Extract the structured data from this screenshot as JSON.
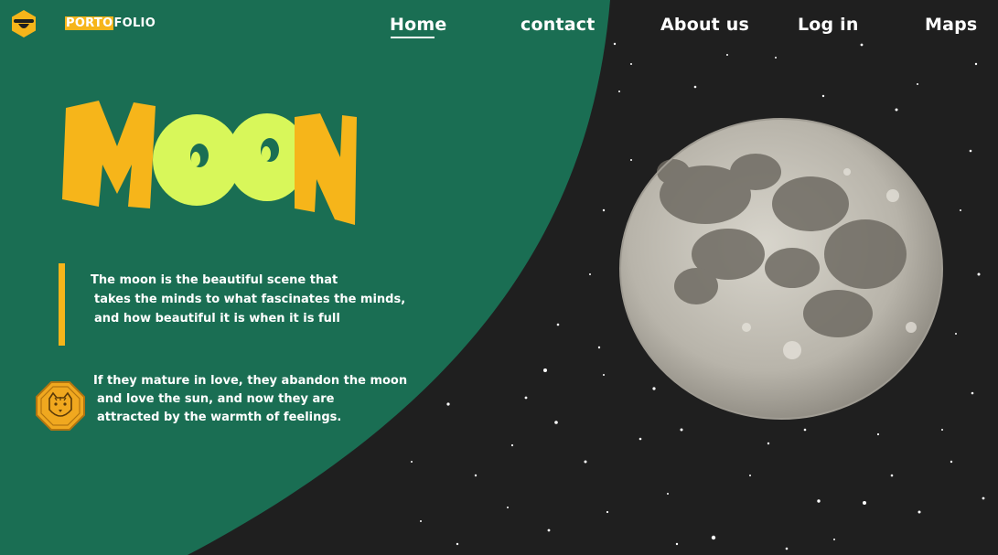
{
  "brand": {
    "highlight": "PORTO",
    "rest": "FOLIO"
  },
  "nav": {
    "home": "Home",
    "contact": "contact",
    "about": "About us",
    "login": "Log in",
    "maps": "Maps",
    "active": "Home"
  },
  "hero": {
    "title": "MOON",
    "paragraph1": [
      "The moon is the beautiful scene that",
      "takes the minds to what fascinates the minds,",
      "and how beautiful it is when it is full"
    ],
    "paragraph2": [
      "If they mature in love, they abandon the moon",
      "and love the sun, and now they are",
      "attracted by the warmth of feelings."
    ]
  },
  "colors": {
    "background": "#1f1f1f",
    "green": "#1a6e53",
    "accent": "#f6b51a",
    "lime": "#d8f75a"
  },
  "icons": {
    "logo": "bee-hexagon-logo-icon",
    "badge": "tiger-octagon-icon",
    "moon": "full-moon-image"
  }
}
